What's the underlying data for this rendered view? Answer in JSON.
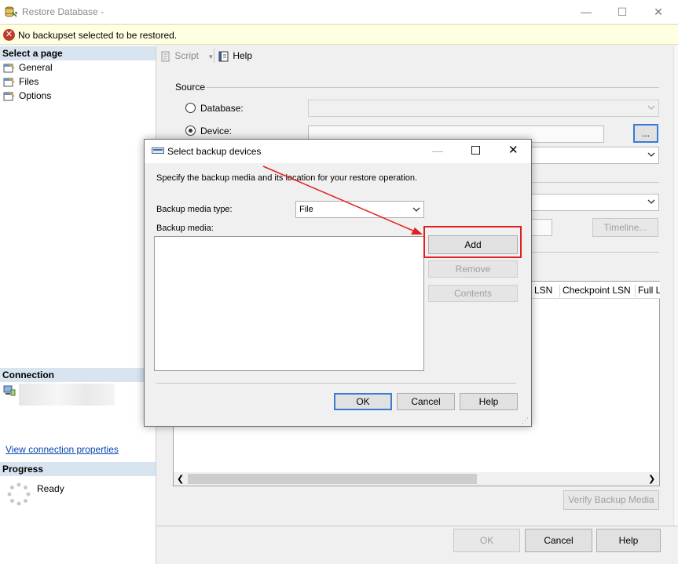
{
  "window": {
    "title": "Restore Database -",
    "minimize_glyph": "—",
    "maximize_glyph": "☐",
    "close_glyph": "✕"
  },
  "error_bar": {
    "icon": "error-icon",
    "message": "No backupset selected to be restored."
  },
  "left_panel": {
    "select_page_header": "Select a page",
    "pages": [
      {
        "label": "General",
        "icon": "wrench-page-icon"
      },
      {
        "label": "Files",
        "icon": "wrench-page-icon"
      },
      {
        "label": "Options",
        "icon": "wrench-page-icon"
      }
    ],
    "connection_header": "Connection",
    "view_connection_link": "View connection properties",
    "progress_header": "Progress",
    "progress_status": "Ready"
  },
  "toolbar": {
    "script_label": "Script",
    "help_label": "Help"
  },
  "source": {
    "section_label": "Source",
    "database_label": "Database:",
    "device_label": "Device:",
    "device_browse_label": "...",
    "timeline_label": "Timeline...",
    "grid_columns_visible": [
      "LSN",
      "Checkpoint LSN",
      "Full LS"
    ],
    "verify_label": "Verify Backup Media"
  },
  "footer": {
    "ok_label": "OK",
    "cancel_label": "Cancel",
    "help_label": "Help"
  },
  "dialog": {
    "title": "Select backup devices",
    "instruction": "Specify the backup media and its location for your restore operation.",
    "media_type_label": "Backup media type:",
    "media_type_value": "File",
    "media_label": "Backup media:",
    "add_label": "Add",
    "remove_label": "Remove",
    "contents_label": "Contents",
    "ok_label": "OK",
    "cancel_label": "Cancel",
    "help_label": "Help",
    "highlight_color": "#e02020"
  }
}
